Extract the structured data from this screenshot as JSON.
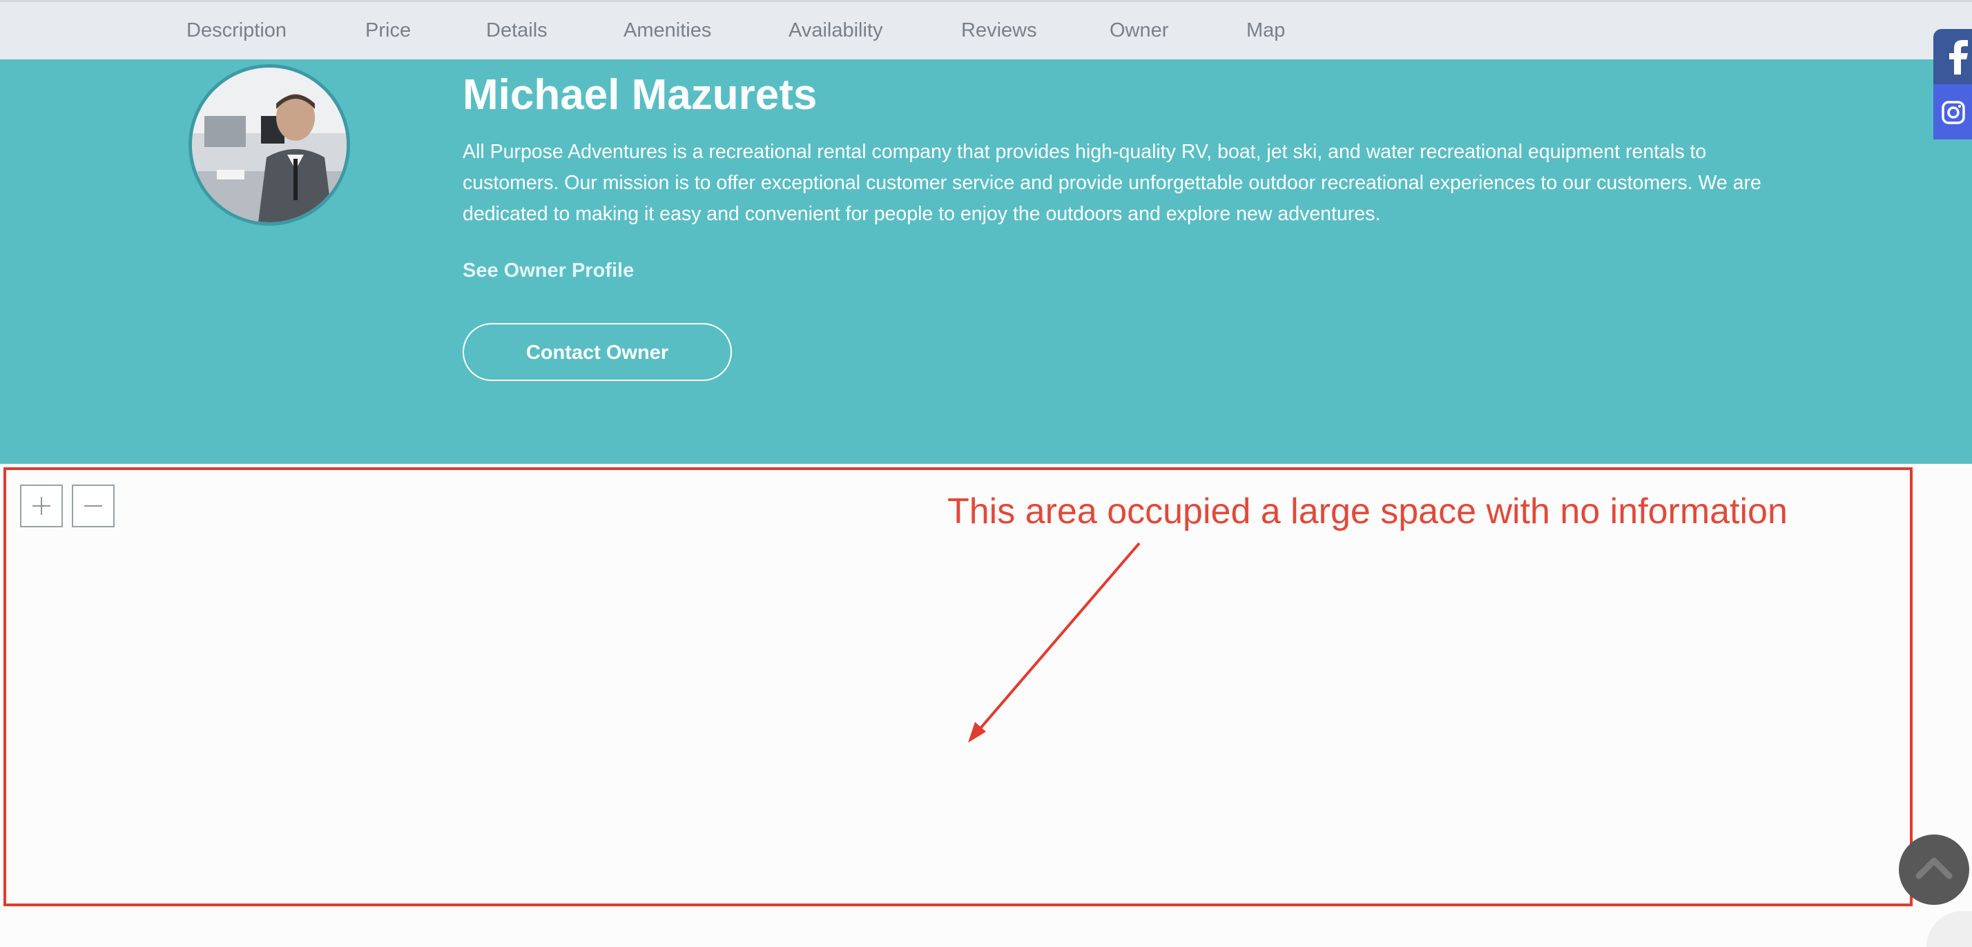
{
  "nav": {
    "tabs": [
      {
        "label": "Description"
      },
      {
        "label": "Price"
      },
      {
        "label": "Details"
      },
      {
        "label": "Amenities"
      },
      {
        "label": "Availability"
      },
      {
        "label": "Reviews"
      },
      {
        "label": "Owner"
      },
      {
        "label": "Map"
      }
    ]
  },
  "owner": {
    "name": "Michael Mazurets",
    "description": "All Purpose Adventures is a recreational rental company that provides high-quality RV, boat, jet ski, and water recreational equipment rentals to customers. Our mission is to offer exceptional customer service and provide unforgettable outdoor recreational experiences to our customers. We are dedicated to making it easy and convenient for people to enjoy the outdoors and explore new adventures.",
    "profile_link": "See Owner Profile",
    "contact_button": "Contact Owner"
  },
  "map": {
    "zoom_in_icon": "plus-icon",
    "zoom_out_icon": "minus-icon"
  },
  "annotation": {
    "text": "This area occupied a large space with no information",
    "color": "#e03c2f"
  },
  "social": [
    {
      "icon": "facebook-icon",
      "color": "#3b5998"
    },
    {
      "icon": "instagram-icon",
      "color": "#4a63e0"
    }
  ],
  "colors": {
    "hero_background": "#58bec4",
    "nav_background": "#e7ebef",
    "back_to_top": "#585858"
  }
}
